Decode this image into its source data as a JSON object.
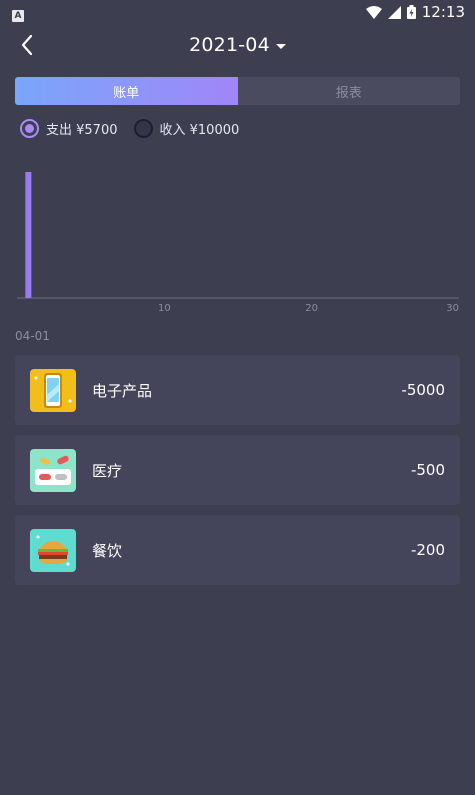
{
  "status_bar": {
    "app_icon": "A",
    "time": "12:13",
    "icons": [
      "wifi-icon",
      "signal-icon",
      "battery-icon"
    ]
  },
  "header": {
    "month": "2021-04"
  },
  "tabs": [
    {
      "label": "账单",
      "active": true
    },
    {
      "label": "报表",
      "active": false
    }
  ],
  "filters": [
    {
      "label": "支出 ¥5700",
      "selected": true
    },
    {
      "label": "收入 ¥10000",
      "selected": false
    }
  ],
  "chart_data": {
    "type": "bar",
    "x": [
      1
    ],
    "values": [
      5700
    ],
    "xlim": [
      0,
      30
    ],
    "xticks": [
      "10",
      "20",
      "30"
    ],
    "bar_color": "#9b7bf2",
    "grid": false
  },
  "list": {
    "date": "04-01",
    "items": [
      {
        "category": "电子产品",
        "amount": "-5000",
        "icon": "phone-icon",
        "icon_bg": "#f2be1c"
      },
      {
        "category": "医疗",
        "amount": "-500",
        "icon": "medical-icon",
        "icon_bg": "#8fe3c8"
      },
      {
        "category": "餐饮",
        "amount": "-200",
        "icon": "burger-icon",
        "icon_bg": "#5fdbd0"
      }
    ]
  },
  "colors": {
    "background": "#3d3e50",
    "card": "#44455a",
    "accent": "#a78bfa"
  }
}
